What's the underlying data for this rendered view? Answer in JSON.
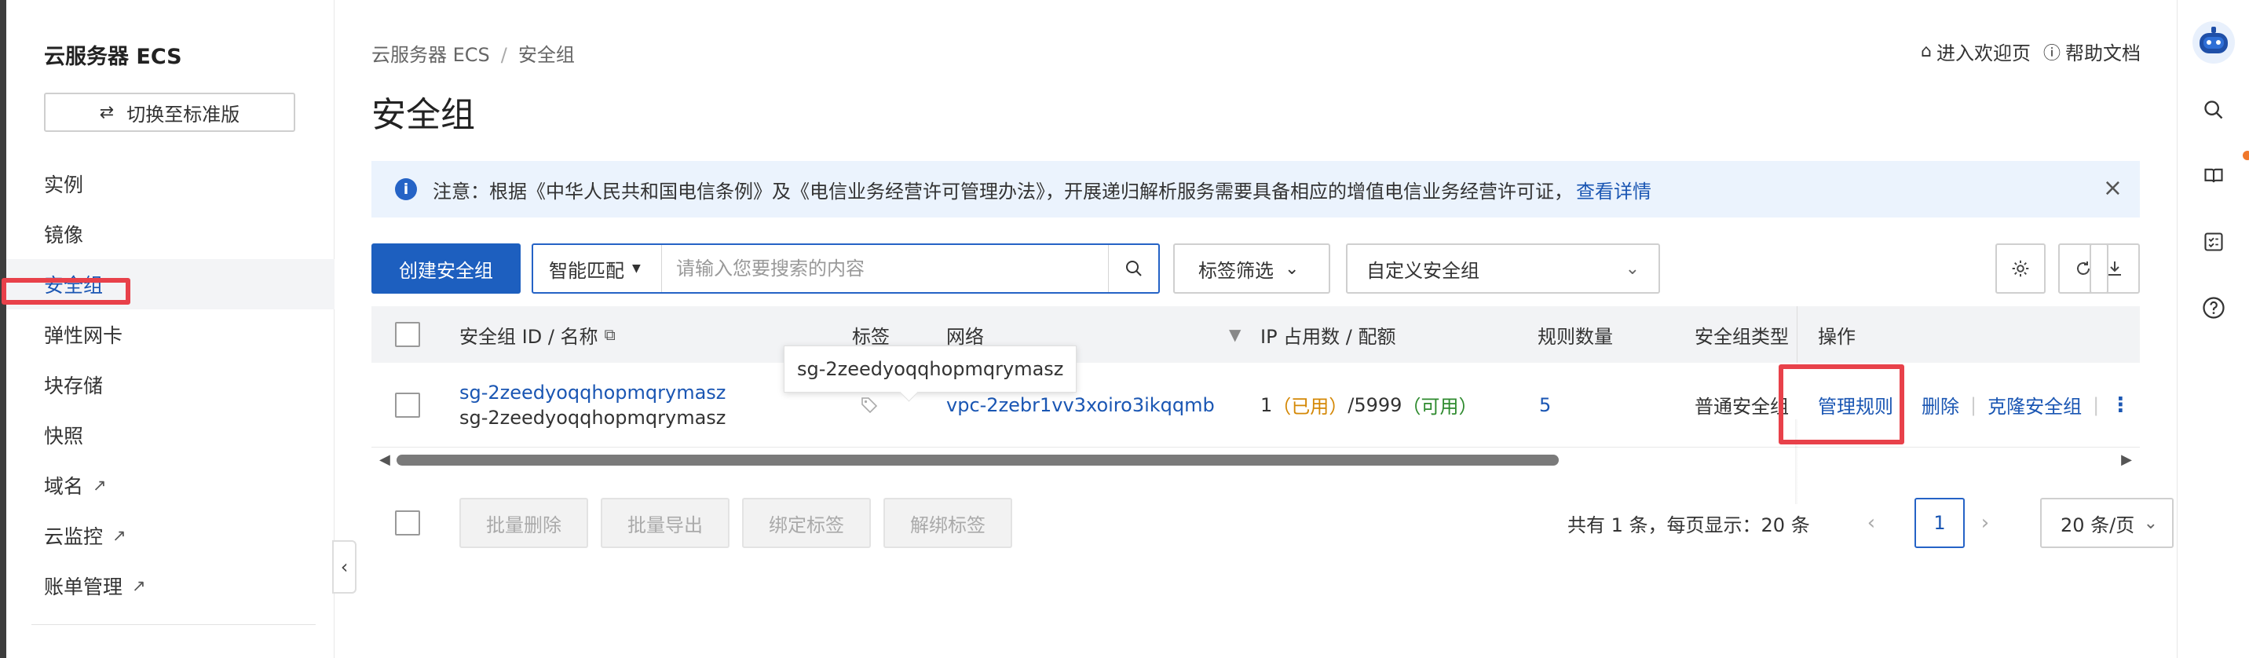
{
  "sidebar": {
    "title": "云服务器 ECS",
    "switch_label": "切换至标准版",
    "items": [
      {
        "label": "实例"
      },
      {
        "label": "镜像"
      },
      {
        "label": "安全组"
      },
      {
        "label": "弹性网卡"
      },
      {
        "label": "块存储"
      },
      {
        "label": "快照"
      },
      {
        "label": "域名"
      },
      {
        "label": "云监控"
      },
      {
        "label": "账单管理"
      }
    ],
    "active_item": "安全组"
  },
  "breadcrumb": {
    "root": "云服务器 ECS",
    "sep": "/",
    "current": "安全组"
  },
  "page_title": "安全组",
  "header_links": {
    "welcome": "进入欢迎页",
    "help": "帮助文档"
  },
  "notice": {
    "text": "注意：根据《中华人民共和国电信条例》及《电信业务经营许可管理办法》，开展递归解析服务需要具备相应的增值电信业务经营许可证，",
    "link": "查看详情"
  },
  "toolbar": {
    "create_label": "创建安全组",
    "search_mode": "智能匹配",
    "search_placeholder": "请输入您要搜索的内容",
    "tag_filter": "标签筛选",
    "sg_select": "自定义安全组"
  },
  "table": {
    "headers": {
      "id_name": "安全组 ID / 名称",
      "tags": "标签",
      "network": "网络",
      "ip_usage": "IP 占用数 / 配额",
      "rule_count": "规则数量",
      "sg_type": "安全组类型",
      "actions": "操作"
    },
    "rows": [
      {
        "id": "sg-2zeedyoqqhopmqrymasz",
        "name": "sg-2zeedyoqqhopmqrymasz",
        "network": "vpc-2zebr1vv3xoiro3ikqqmb",
        "ip_count": "1",
        "used_label": "（已用）",
        "quota": "/5999",
        "avail_label": "（可用）",
        "rule_count": "5",
        "sg_type": "普通安全组",
        "actions": {
          "manage": "管理规则",
          "delete": "删除",
          "clone": "克隆安全组"
        }
      }
    ],
    "tooltip": "sg-2zeedyoqqhopmqrymasz"
  },
  "bulk_actions": {
    "delete": "批量删除",
    "export": "批量导出",
    "bind_tag": "绑定标签",
    "unbind_tag": "解绑标签"
  },
  "pagination": {
    "summary": "共有 1 条，每页显示：20 条",
    "current_page": "1",
    "page_size": "20 条/页"
  },
  "colors": {
    "primary": "#1d5fbf",
    "link": "#1a56b3",
    "highlight": "#e8414a",
    "used": "#d48806",
    "available": "#2e8a2e",
    "notice_bg": "#ebf3fd"
  }
}
